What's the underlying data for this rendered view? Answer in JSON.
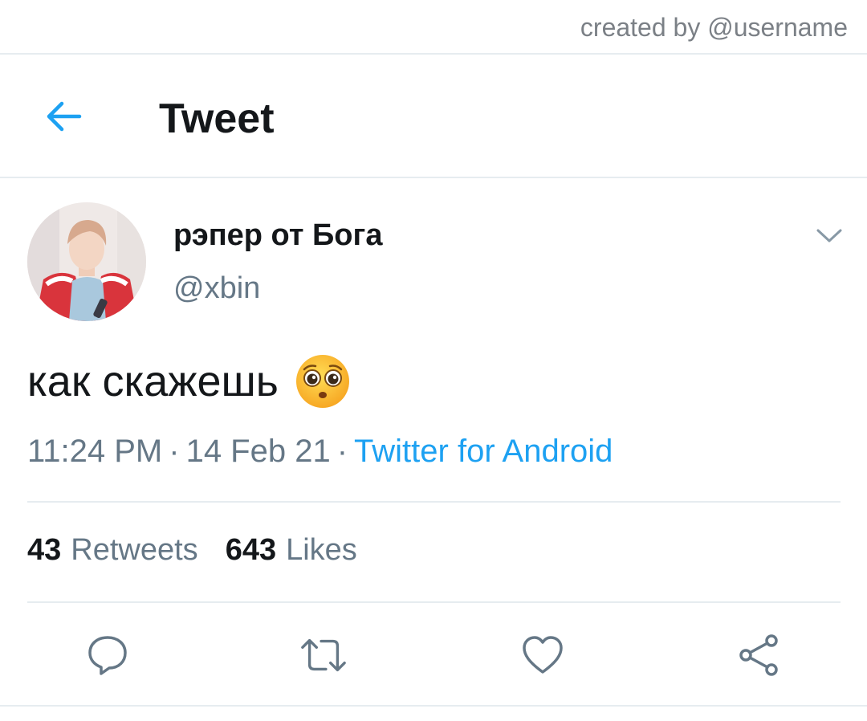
{
  "watermark": "created by @username",
  "header": {
    "title": "Tweet",
    "back_icon": "arrow-left-icon"
  },
  "tweet": {
    "author": {
      "display_name": "рэпер от Бога",
      "handle": "@xbin"
    },
    "text": "как скажешь",
    "emoji": "pleading-face",
    "time": "11:24 PM",
    "date": "14 Feb 21",
    "source": "Twitter for Android",
    "separator": "·",
    "stats": {
      "retweets_count": "43",
      "retweets_label": "Retweets",
      "likes_count": "643",
      "likes_label": "Likes"
    }
  },
  "actions": [
    "reply-icon",
    "retweet-icon",
    "like-icon",
    "share-icon"
  ],
  "colors": {
    "accent": "#1da1f2",
    "text_primary": "#14171a",
    "text_secondary": "#657786",
    "divider": "#e6ecf0"
  }
}
